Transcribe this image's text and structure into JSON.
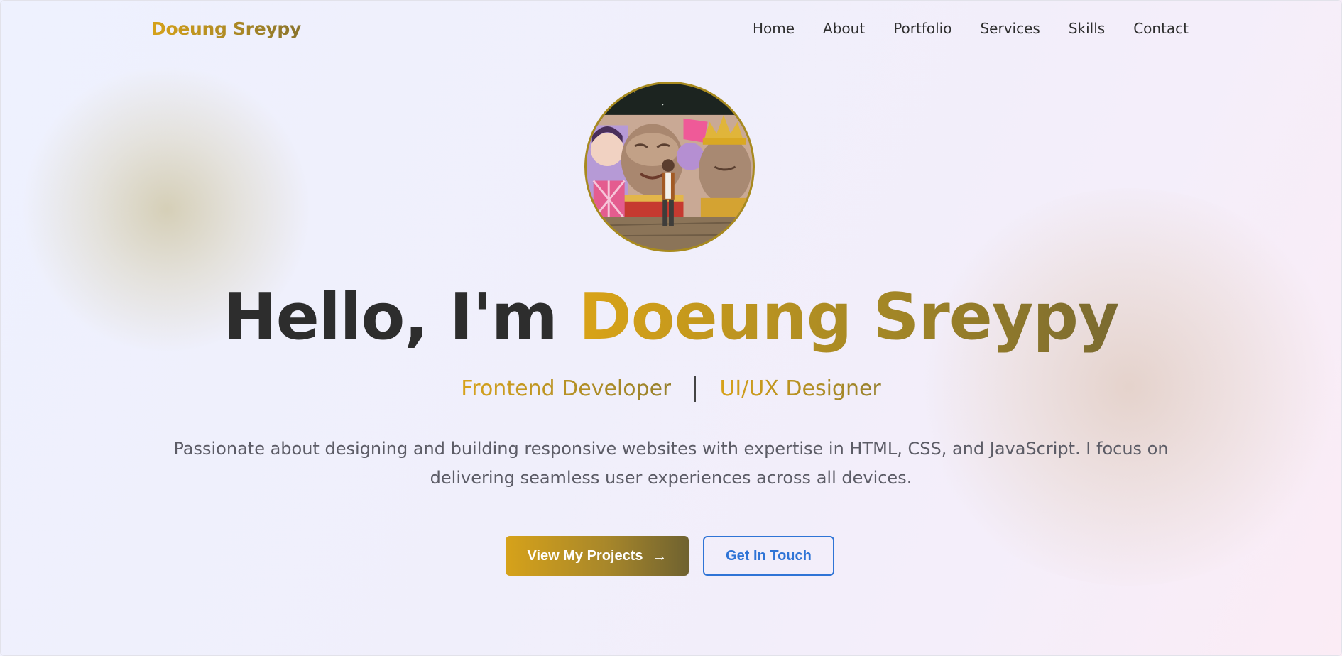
{
  "nav": {
    "brand": "Doeung Sreypy",
    "links": [
      "Home",
      "About",
      "Portfolio",
      "Services",
      "Skills",
      "Contact"
    ]
  },
  "hero": {
    "greeting": "Hello, I'm",
    "name": "Doeung Sreypy",
    "roles": [
      "Frontend Developer",
      "UI/UX Designer"
    ],
    "intro": "Passionate about designing and building responsive websites with expertise in HTML, CSS, and JavaScript. I focus on delivering seamless user experiences across all devices.",
    "primary_button": "View My Projects",
    "secondary_button": "Get In Touch"
  },
  "icons": {
    "primary_button_icon": "arrow-right-icon"
  },
  "colors": {
    "gold": "#d6a21a",
    "olive": "#7a6a30",
    "link_blue": "#2f74d6",
    "heading": "#2d2d2d"
  }
}
